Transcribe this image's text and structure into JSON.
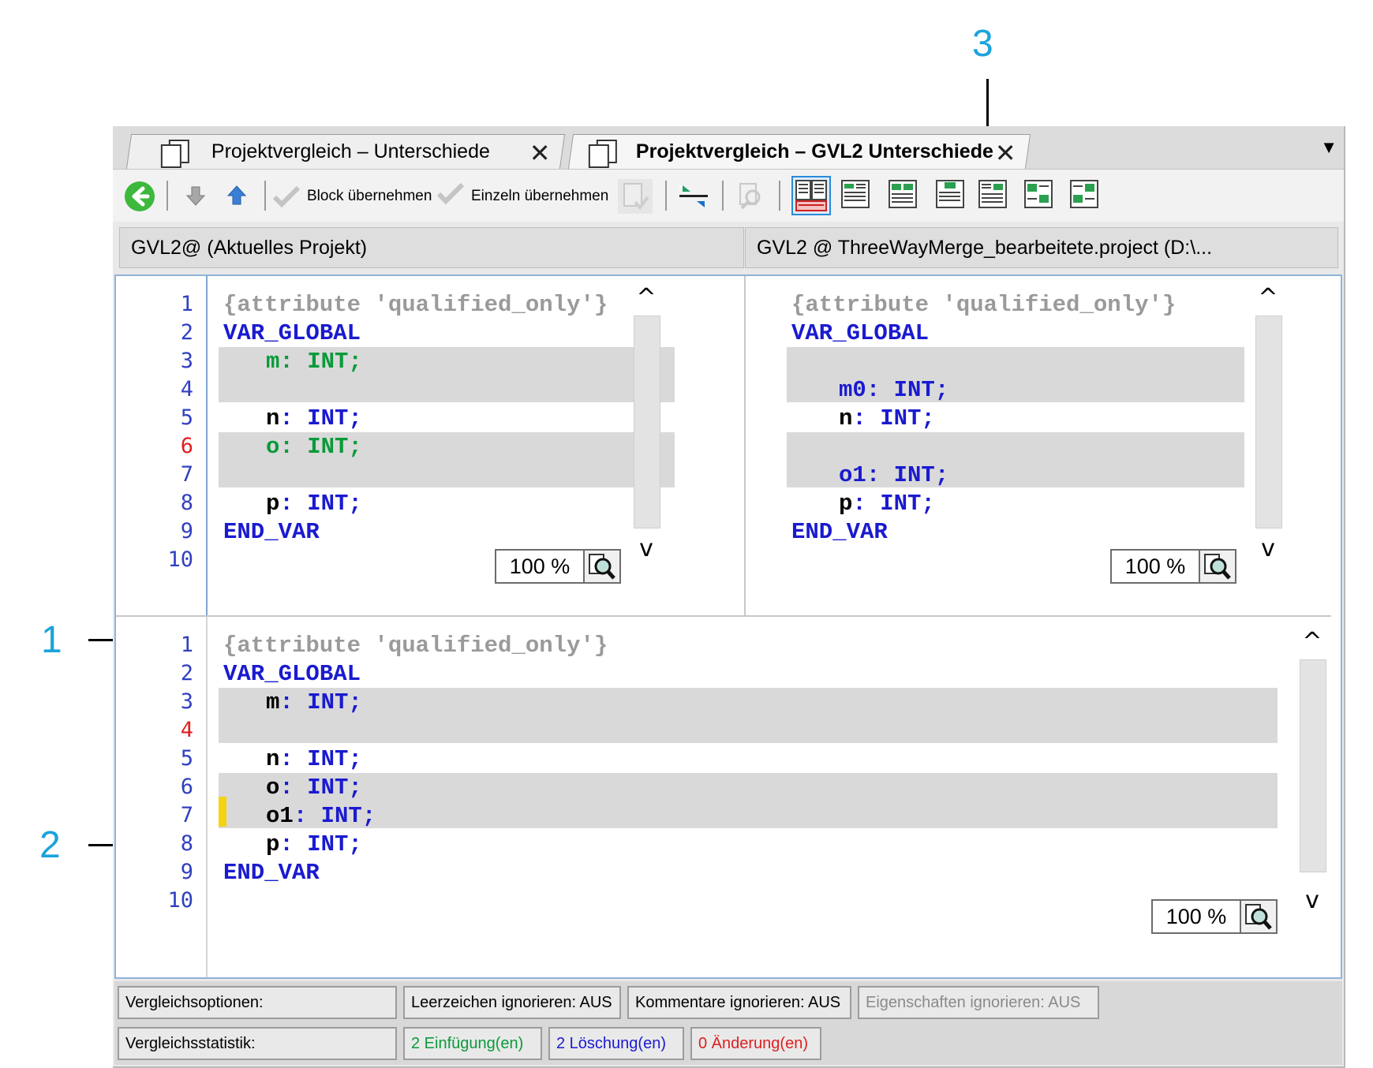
{
  "callouts": {
    "c1": "1",
    "c2": "2",
    "c3": "3"
  },
  "tabs": [
    {
      "label": "Projektvergleich – Unterschiede",
      "close": "✕"
    },
    {
      "label": "Projektvergleich – GVL2 Unterschiede",
      "close": "✕"
    }
  ],
  "tab_menu_glyph": "▼",
  "toolbar": {
    "block_label": "Block übernehmen",
    "single_label": "Einzeln übernehmen"
  },
  "panes": {
    "left_header": "GVL2@ (Aktuelles Projekt)",
    "right_header": "GVL2 @ ThreeWayMerge_bearbeitete.project (D:\\...",
    "zoom": "100 %",
    "line_numbers": [
      "1",
      "2",
      "3",
      "4",
      "5",
      "6",
      "7",
      "8",
      "9",
      "10"
    ],
    "scroll_up": "^",
    "scroll_down": "v"
  },
  "code": {
    "attr": "{attribute 'qualified_only'}",
    "var_global": "VAR_GLOBAL",
    "end_var": "END_VAR",
    "int": "INT;",
    "colon": ":",
    "m": "m",
    "m0": "m0",
    "n": "n",
    "o": "o",
    "o1": "o1",
    "p": "p"
  },
  "status": {
    "options_label": "Vergleichsoptionen:",
    "whitespace": "Leerzeichen ignorieren: AUS",
    "comments": "Kommentare ignorieren: AUS",
    "properties": "Eigenschaften ignorieren: AUS",
    "stats_label": "Vergleichsstatistik:",
    "insertions": "2 Einfügung(en)",
    "deletions": "2 Löschung(en)",
    "changes": "0 Änderung(en)"
  },
  "colors": {
    "accent": "#1aa3dc",
    "insert": "#0a9a3a",
    "delete": "#1a1ad0",
    "change": "#e02020",
    "highlight": "#d9d9d9"
  }
}
